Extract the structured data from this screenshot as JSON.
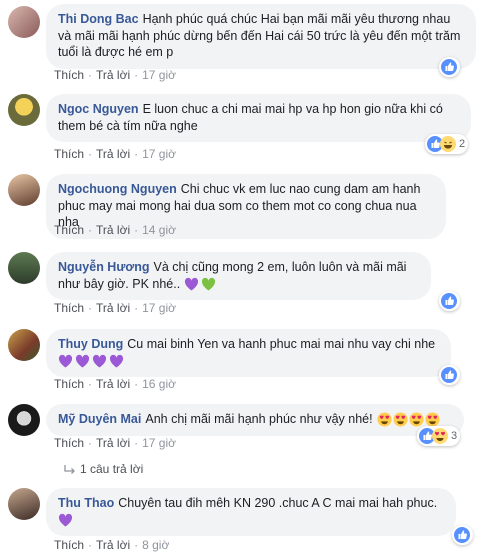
{
  "actions": {
    "like": "Thích",
    "reply": "Trả lời",
    "sep": "·"
  },
  "comments": [
    {
      "author": "Thi Dong Bac",
      "text": "Hạnh phúc quá chúc Hai bạn mãi mãi yêu thương nhau và mãi mãi hạnh phúc dừng bến đến Hai cái 50 trức là yêu đến một trăm tuổi là được hé em p",
      "time": "17 giờ",
      "reaction_count": ""
    },
    {
      "author": "Ngoc Nguyen",
      "text": "E luon chuc a chi mai mai hp va hp hon gio nữa khi có them bé cà tím nữa nghe",
      "time": "17 giờ",
      "reaction_count": "2"
    },
    {
      "author": "Ngochuong Nguyen",
      "text": "Chi chuc vk em luc nao cung dam am hanh phuc may mai mong hai dua som co them mot co cong chua nua nha",
      "time": "14 giờ",
      "reaction_count": ""
    },
    {
      "author": "Nguyễn Hương",
      "text": "Và chị cũng mong 2 em, luôn luôn và mãi mãi như bây giờ. PK nhé..",
      "time": "17 giờ",
      "reaction_count": ""
    },
    {
      "author": "Thuy Dung",
      "text": "Cu mai binh Yen va hanh phuc mai mai nhu vay chi nhe",
      "time": "16 giờ",
      "reaction_count": ""
    },
    {
      "author": "Mỹ Duyên Mai",
      "text": "Anh chị mãi mãi hạnh phúc như vậy nhé!",
      "time": "17 giờ",
      "reaction_count": "3"
    },
    {
      "author": "Thu Thao",
      "text": "Chuyên tau đih mêh KN 290 .chuc A C mai mai hah phuc.",
      "time": "8 giờ",
      "reaction_count": ""
    }
  ],
  "replies_link": "1 câu trả lời",
  "colors": {
    "author": "#385898",
    "bubble": "#f2f3f5",
    "like_blue": "#5890ff",
    "purple_heart": "#9b59d6",
    "green_heart": "#7cc142"
  }
}
